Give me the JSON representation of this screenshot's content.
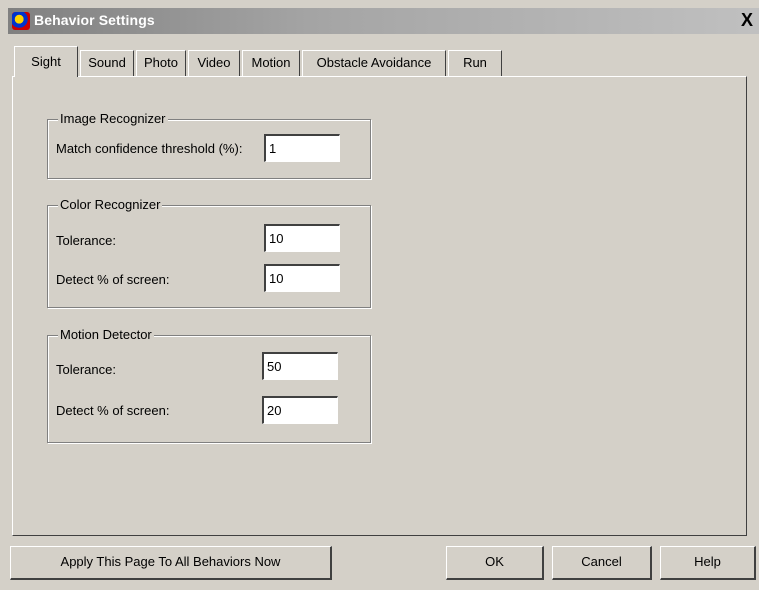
{
  "window": {
    "title": "Behavior Settings",
    "close_glyph": "X"
  },
  "tabs": [
    {
      "label": "Sight",
      "active": true
    },
    {
      "label": "Sound",
      "active": false
    },
    {
      "label": "Photo",
      "active": false
    },
    {
      "label": "Video",
      "active": false
    },
    {
      "label": "Motion",
      "active": false
    },
    {
      "label": "Obstacle Avoidance",
      "active": false
    },
    {
      "label": "Run",
      "active": false
    }
  ],
  "image_recognizer": {
    "legend": "Image Recognizer",
    "threshold_label": "Match confidence threshold (%):",
    "threshold_value": "1"
  },
  "color_recognizer": {
    "legend": "Color Recognizer",
    "tolerance_label": "Tolerance:",
    "tolerance_value": "10",
    "detect_label": "Detect % of screen:",
    "detect_value": "10"
  },
  "motion_detector": {
    "legend": "Motion Detector",
    "tolerance_label": "Tolerance:",
    "tolerance_value": "50",
    "detect_label": "Detect % of screen:",
    "detect_value": "20"
  },
  "buttons": {
    "apply_all": "Apply This Page To All Behaviors Now",
    "ok": "OK",
    "cancel": "Cancel",
    "help": "Help"
  }
}
